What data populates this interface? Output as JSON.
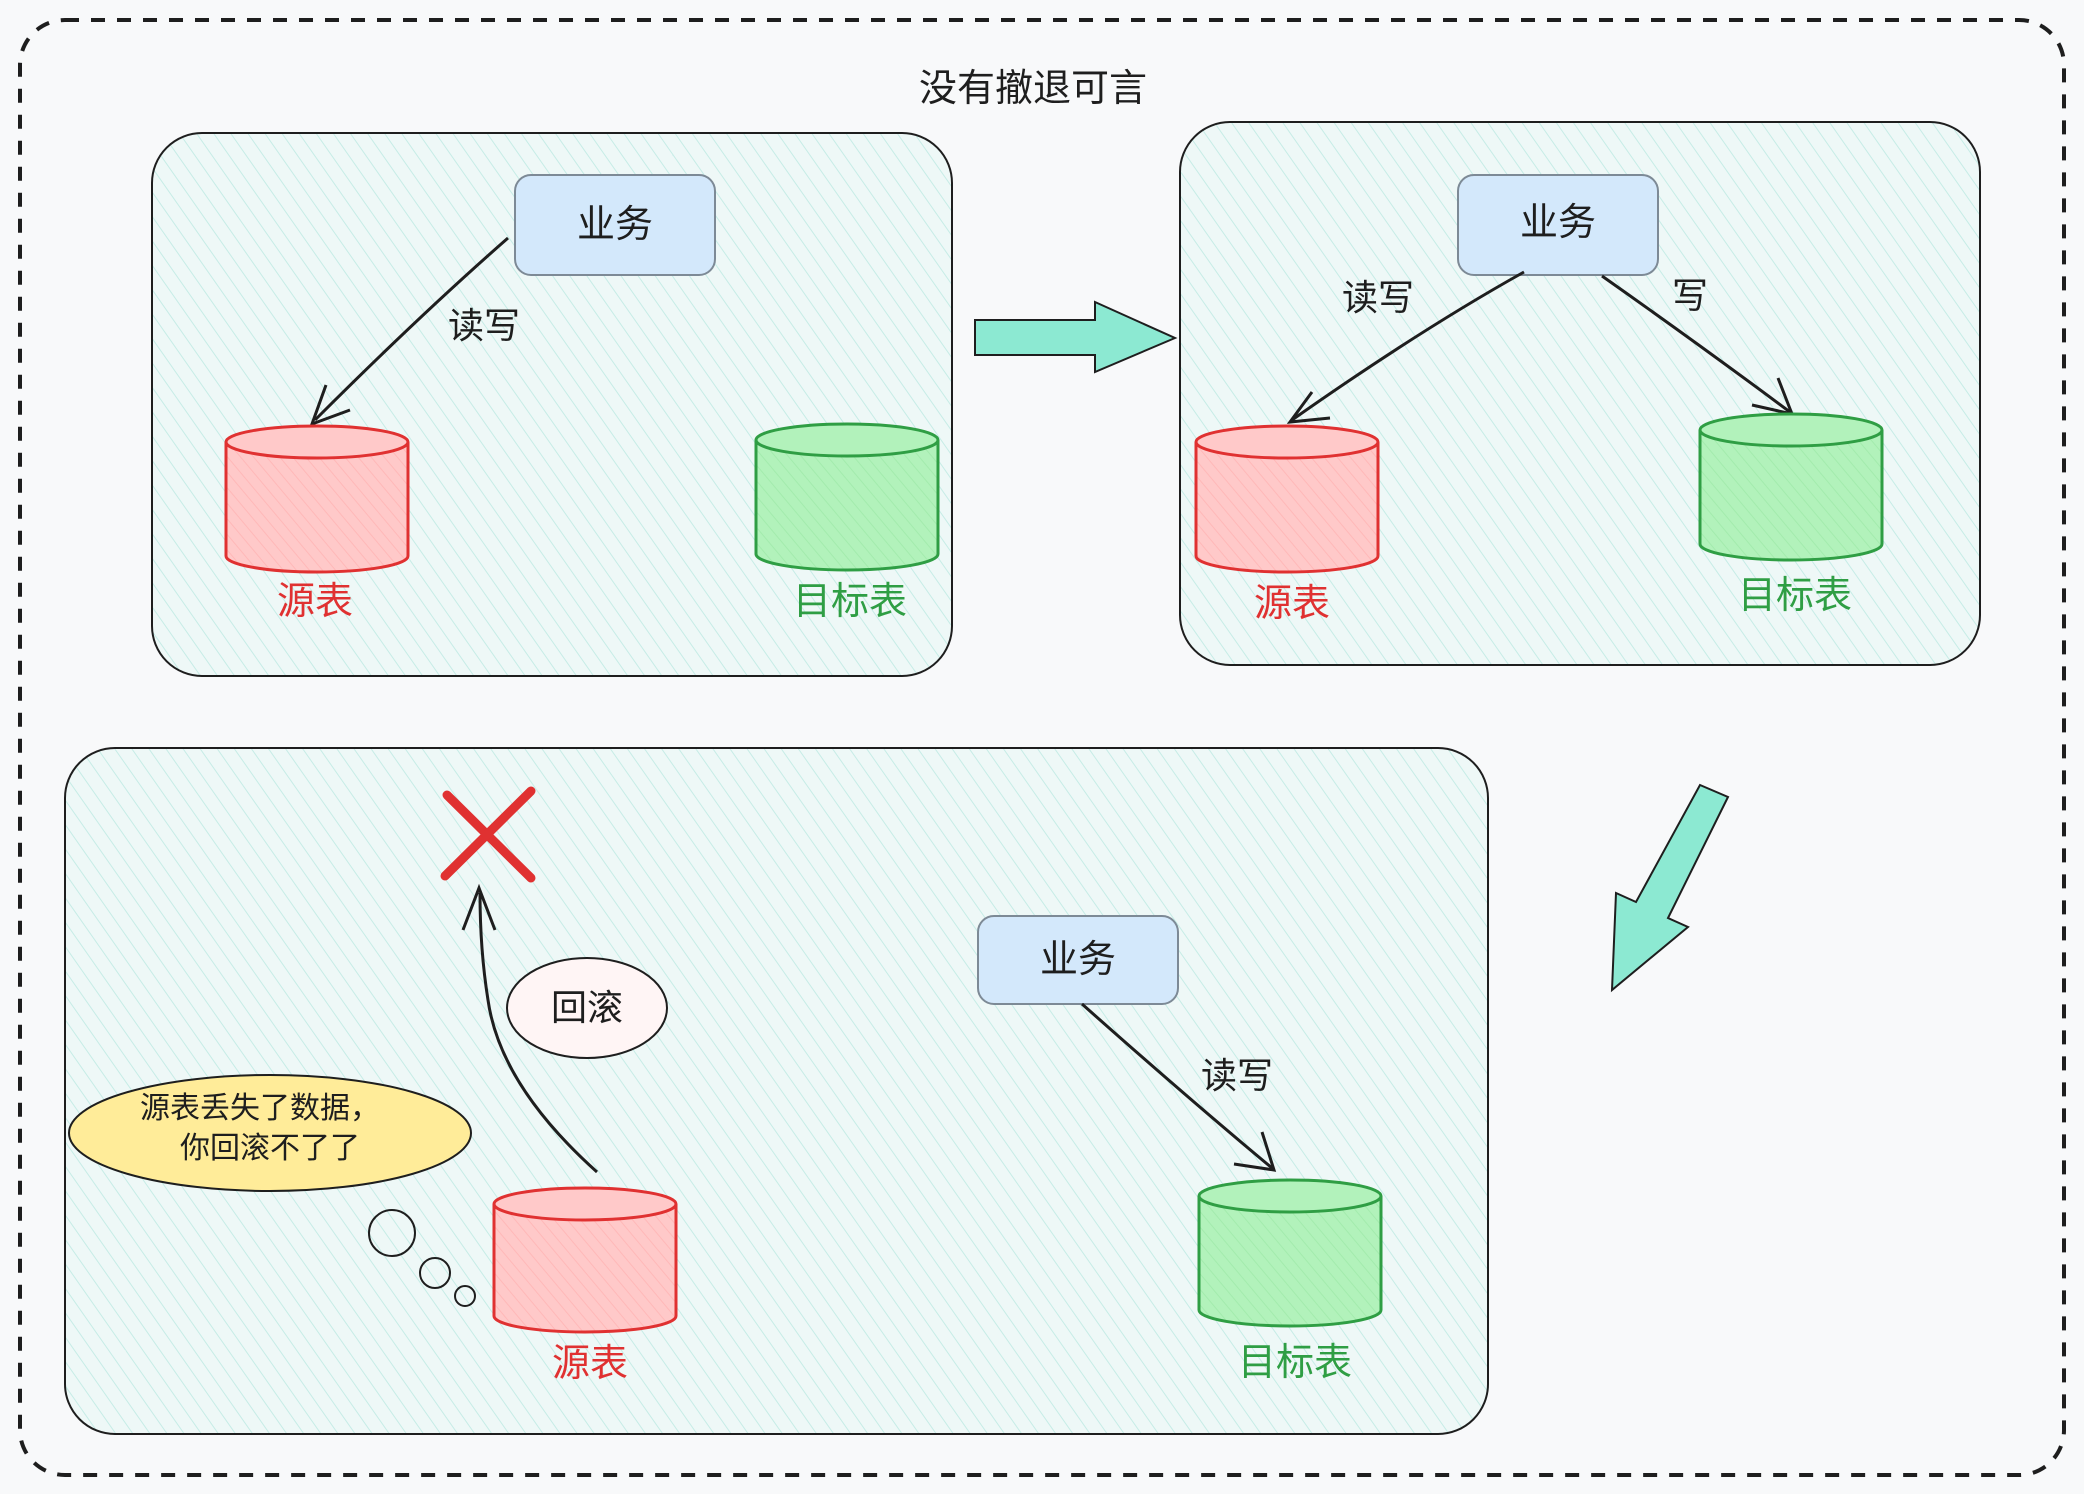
{
  "title": "没有撤退可言",
  "panels": {
    "p1": {
      "service": "业务",
      "edge_rw": "读写",
      "source": "源表",
      "target": "目标表"
    },
    "p2": {
      "service": "业务",
      "edge_rw": "读写",
      "edge_w": "写",
      "source": "源表",
      "target": "目标表"
    },
    "p3": {
      "service": "业务",
      "edge_rw": "读写",
      "rollback": "回滚",
      "thought_line1": "源表丢失了数据，",
      "thought_line2": "你回滚不了了",
      "source": "源表",
      "target": "目标表"
    }
  },
  "colors": {
    "panel_fill": "#eef8f7",
    "panel_hatch": "#bfe9e2",
    "service_fill": "#d3e8fb",
    "source_fill": "#ffc9c9",
    "source_stroke": "#e03131",
    "target_fill": "#b2f2bb",
    "target_stroke": "#2f9e44",
    "flow_arrow": "#8ce9d2",
    "thought_fill": "#ffec99",
    "rollback_fill": "#fff5f5",
    "cross": "#e03131"
  }
}
